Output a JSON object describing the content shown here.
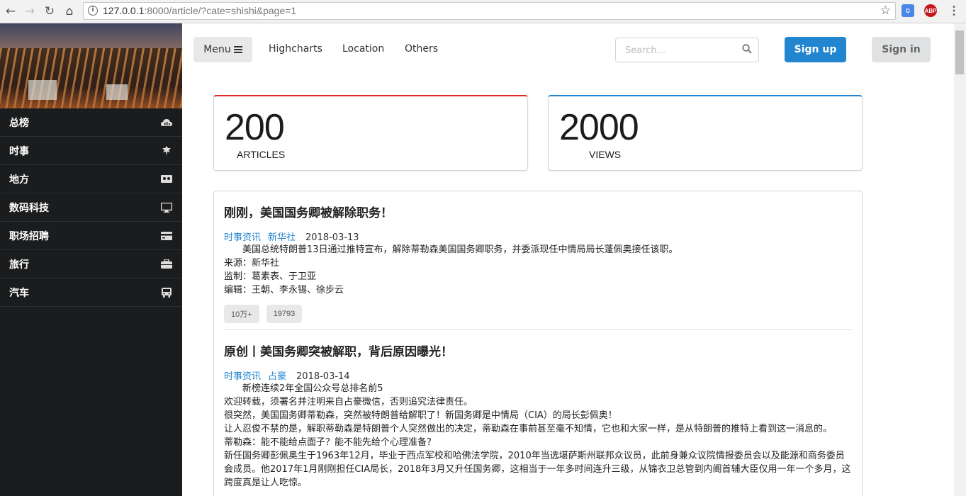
{
  "browser": {
    "url_host": "127.0.0.1",
    "url_path": ":8000/article/?cate=shishi&page=1",
    "ext_translate": "G",
    "ext_abp": "ABP"
  },
  "sidebar": {
    "items": [
      {
        "label": "总榜",
        "icon": "cloud-upload-icon"
      },
      {
        "label": "时事",
        "icon": "leaf-icon"
      },
      {
        "label": "地方",
        "icon": "map-icon"
      },
      {
        "label": "数码科技",
        "icon": "monitor-icon"
      },
      {
        "label": "职场招聘",
        "icon": "credit-card-icon"
      },
      {
        "label": "旅行",
        "icon": "suitcase-icon"
      },
      {
        "label": "汽车",
        "icon": "bus-icon"
      }
    ]
  },
  "topnav": {
    "menu_label": "Menu",
    "links": [
      "Highcharts",
      "Location",
      "Others"
    ],
    "search_placeholder": "Search...",
    "signup_label": "Sign up",
    "signin_label": "Sign in"
  },
  "stats": {
    "articles": {
      "value": "200",
      "label": "ARTICLES",
      "color": "#db2828"
    },
    "views": {
      "value": "2000",
      "label": "VIEWS",
      "color": "#2185d0"
    }
  },
  "articles": [
    {
      "title": "刚刚，美国国务卿被解除职务！",
      "tags": [
        "时事资讯",
        "新华社"
      ],
      "date": "2018-03-13",
      "lines": [
        "　　美国总统特朗普13日通过推特宣布，解除蒂勒森美国国务卿职务，并委派现任中情局局长蓬佩奥接任该职。",
        "来源：新华社",
        "监制：葛素表、于卫亚",
        "编辑：王朝、李永锡、徐步云"
      ],
      "labels": [
        "10万+",
        "19793"
      ]
    },
    {
      "title": "原创丨美国务卿突被解职，背后原因曝光！",
      "tags": [
        "时事资讯",
        "占豪"
      ],
      "date": "2018-03-14",
      "lines": [
        "　　新榜连续2年全国公众号总排名前5",
        "欢迎转载，须署名并注明来自占豪微信，否则追究法律责任。",
        "很突然，美国国务卿蒂勒森，突然被特朗普给解职了！新国务卿是中情局（CIA）的局长彭佩奥！",
        "让人忍俊不禁的是，解职蒂勒森是特朗普个人突然做出的决定，蒂勒森在事前甚至毫不知情，它也和大家一样，是从特朗普的推特上看到这一消息的。",
        "蒂勒森：能不能给点面子？能不能先给个心理准备？",
        "新任国务卿彭佩奥生于1963年12月，毕业于西点军校和哈佛法学院，2010年当选堪萨斯州联邦众议员，此前身兼众议院情报委员会以及能源和商务委员会成员。他2017年1月刚刚担任CIA局长，2018年3月又升任国务卿，这相当于一年多时间连升三级，从锦衣卫总管到内阁首辅大臣仅用一年一个多月，这跨度真是让人吃惊。"
      ]
    }
  ]
}
